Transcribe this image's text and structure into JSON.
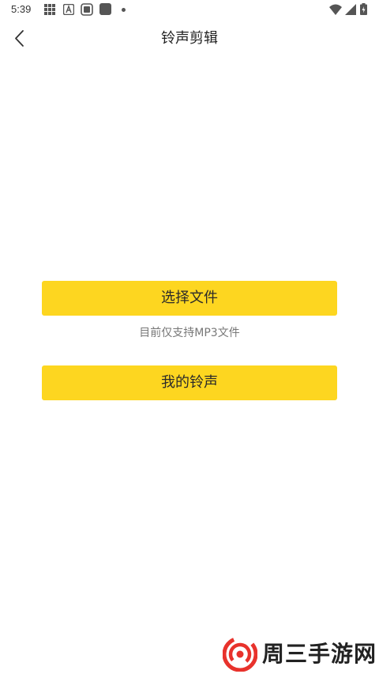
{
  "status_bar": {
    "time": "5:39",
    "icons": [
      "grid-icon",
      "a-icon",
      "photo-icon",
      "square-icon",
      "dot-icon",
      "wifi-icon",
      "signal-icon",
      "battery-icon"
    ]
  },
  "header": {
    "title": "铃声剪辑",
    "back_icon": "chevron-left-icon"
  },
  "main": {
    "select_file_label": "选择文件",
    "hint": "目前仅支持MP3文件",
    "my_ringtones_label": "我的铃声"
  },
  "watermark": {
    "text": "周三手游网"
  },
  "colors": {
    "accent": "#fdd620",
    "background": "#ffffff",
    "watermark_red": "#e8322c"
  }
}
